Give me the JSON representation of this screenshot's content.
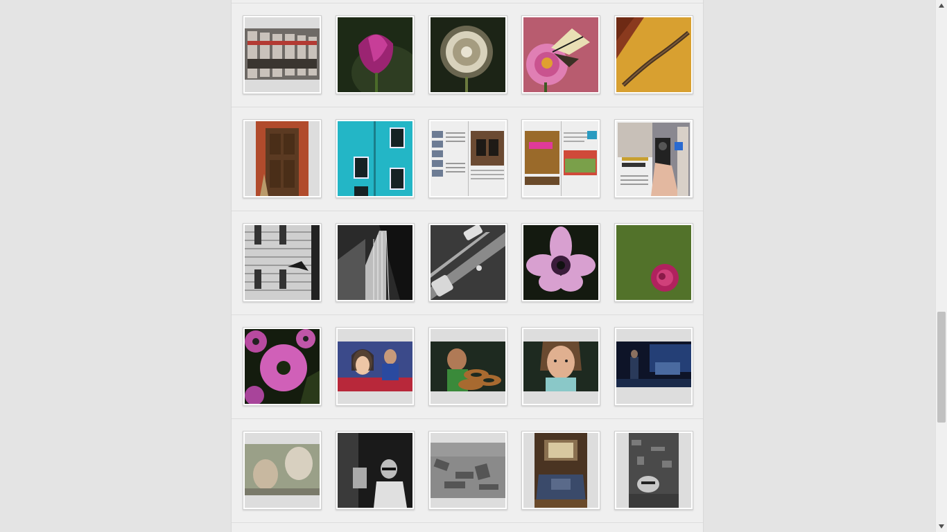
{
  "gallery": {
    "rows": [
      [
        {
          "name": "photo-shop-window-reflection",
          "icon": "shop-reflection"
        },
        {
          "name": "photo-purple-tulip",
          "icon": "tulip"
        },
        {
          "name": "photo-dandelion",
          "icon": "dandelion"
        },
        {
          "name": "photo-butterfly-on-pink-flower",
          "icon": "butterfly-flower"
        },
        {
          "name": "photo-branch-on-yellow-wall",
          "icon": "branch-wall"
        }
      ],
      [
        {
          "name": "photo-wooden-door-red-wall",
          "icon": "door"
        },
        {
          "name": "photo-turquoise-house-windows",
          "icon": "turquoise-house"
        },
        {
          "name": "photo-magazine-spread-windows",
          "icon": "magazine"
        },
        {
          "name": "photo-magazine-spread-food",
          "icon": "magazine-food"
        },
        {
          "name": "photo-magazine-spread-phone-photography",
          "icon": "magazine-phone"
        }
      ],
      [
        {
          "name": "photo-bw-house-with-bird",
          "icon": "bw-house"
        },
        {
          "name": "photo-bw-bridge",
          "icon": "bw-bridge"
        },
        {
          "name": "photo-bw-street-cars",
          "icon": "bw-street"
        },
        {
          "name": "photo-pink-anemone",
          "icon": "anemone"
        },
        {
          "name": "photo-rose-on-grass",
          "icon": "rose-grass"
        }
      ],
      [
        {
          "name": "photo-pink-daisies",
          "icon": "daisies"
        },
        {
          "name": "photo-girl-and-boy",
          "icon": "portrait-girl"
        },
        {
          "name": "photo-boy-with-simit",
          "icon": "simit-boy"
        },
        {
          "name": "photo-girl-portrait",
          "icon": "portrait-girl-2"
        },
        {
          "name": "photo-night-street",
          "icon": "night-street"
        }
      ],
      [
        {
          "name": "photo-faded-portraits",
          "icon": "faded-portraits"
        },
        {
          "name": "photo-bw-man-walking",
          "icon": "bw-man"
        },
        {
          "name": "photo-bw-rubble",
          "icon": "bw-rubble"
        },
        {
          "name": "photo-abandoned-room",
          "icon": "abandoned-room"
        },
        {
          "name": "photo-bw-debris-face",
          "icon": "bw-debris"
        }
      ]
    ]
  },
  "scrollbar": {
    "position": 0.65
  }
}
